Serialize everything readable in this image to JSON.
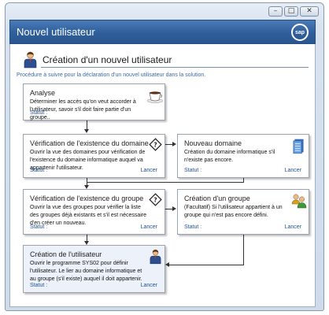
{
  "window": {
    "title": "Nouvel utilisateur",
    "logo_text": "sap"
  },
  "header": {
    "title": "Création d'un nouvel utilisateur",
    "description": "Procédure à suivre pour la déclaration d'un nouvel utilisateur dans la solution."
  },
  "steps": {
    "analyse": {
      "title": "Analyse",
      "text": "Déterminer les accès qu'on veut accorder à l'utilisateur, savoir s'il doit faire partie d'un groupe..",
      "status": "Statut :"
    },
    "verif_domaine": {
      "title": "Vérification de l'existence du domaine",
      "text": "Ouvrir la vue des domaines pour vérification de l'existence du domaine informatique auquel va appartenir l'utilisateur.",
      "status": "Statut :",
      "launch": "Lancer"
    },
    "nouveau_domaine": {
      "title": "Nouveau domaine",
      "text": "Création du domaine informatique s'il n'existe pas encore.",
      "status": "Statut :",
      "launch": "Lancer"
    },
    "verif_groupe": {
      "title": "Vérification de l'existence du groupe",
      "text": "Ouvrir la vue des groupes pour vérifier la liste des groupes déjà existants et s'il est nécessaire d'en créer un nouveau.",
      "status": "Statut :",
      "launch": "Lancer"
    },
    "creation_groupe": {
      "title": "Création d'un groupe",
      "text": "(Facultatif) Si l'utilisateur appartient à un groupe qui n'est pas encore défini.",
      "status": "Statut :",
      "launch": "Lancer"
    },
    "creation_utilisateur": {
      "title": "Création de l'utilisateur",
      "text": "Ouvrir le programme SYS02 pour définir l'utilisateur. Le lier au domaine informatique et au groupe (s'il existe) auquel il doit appartenir.",
      "status": "Statut :",
      "launch": "Lancer"
    }
  },
  "colors": {
    "titlebar": "#2f5f9b",
    "link": "#1f4f96",
    "description": "#3a6aa8"
  }
}
